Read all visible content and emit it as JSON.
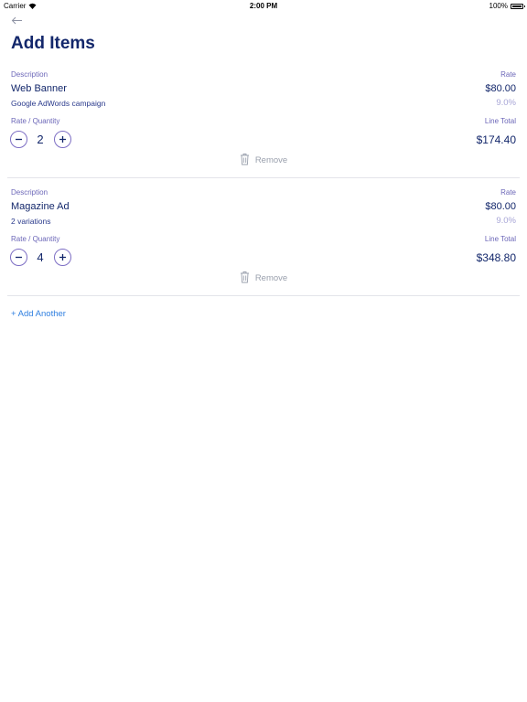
{
  "status": {
    "carrier": "Carrier",
    "time": "2:00 PM",
    "battery": "100%"
  },
  "header": {
    "title": "Add Items"
  },
  "labels": {
    "description": "Description",
    "rate": "Rate",
    "rate_quantity": "Rate / Quantity",
    "line_total": "Line Total",
    "remove": "Remove"
  },
  "items": [
    {
      "name": "Web Banner",
      "detail": "Google AdWords campaign",
      "rate": "$80.00",
      "tax": "9.0%",
      "quantity": "2",
      "line_total": "$174.40"
    },
    {
      "name": "Magazine Ad",
      "detail": "2 variations",
      "rate": "$80.00",
      "tax": "9.0%",
      "quantity": "4",
      "line_total": "$348.80"
    }
  ],
  "add_another": "+ Add Another",
  "colors": {
    "title": "#13276b",
    "label": "#6c67b8",
    "link": "#2f7fe0",
    "muted": "#9aa0ad"
  }
}
